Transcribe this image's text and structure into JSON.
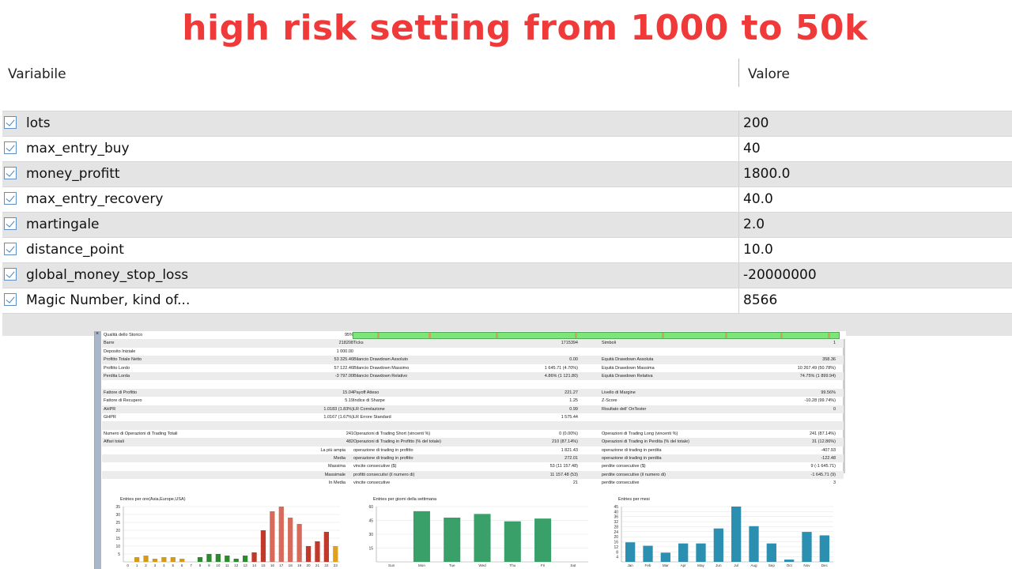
{
  "title": "high risk setting from 1000 to 50k",
  "header": {
    "col1": "Variabile",
    "col2": "Valore"
  },
  "params": [
    {
      "name": "lots",
      "value": "200"
    },
    {
      "name": "max_entry_buy",
      "value": "40"
    },
    {
      "name": "money_profitt",
      "value": "1800.0"
    },
    {
      "name": "max_entry_recovery",
      "value": "40.0"
    },
    {
      "name": "martingale",
      "value": "2.0"
    },
    {
      "name": "distance_point",
      "value": "10.0"
    },
    {
      "name": "global_money_stop_loss",
      "value": "-20000000"
    },
    {
      "name": "Magic Number, kind of...",
      "value": "8566"
    }
  ],
  "report": {
    "close_glyph": "×",
    "rows": [
      [
        "Qualità dello Storico",
        "95%",
        "",
        "",
        "",
        "",
        ""
      ],
      [
        "Barre",
        "218208",
        "Ticks",
        "1715394",
        "Simboli",
        "1",
        ""
      ],
      [
        "Deposito Iniziale",
        "1 000.00",
        "",
        "",
        "",
        "",
        ""
      ],
      [
        "Profitto Totale Netto",
        "53 325.46",
        "Bilancio Drawdown Assoluto",
        "0.00",
        "Equità Drawdown Assoluta",
        "358.36",
        ""
      ],
      [
        "Profitto Lordo",
        "57 122.46",
        "Bilancio Drawdown Massimo",
        "1 645.71 (4.70%)",
        "Equità Drawdown Massima",
        "10 267.49 (50.78%)",
        ""
      ],
      [
        "Perdita Lorda",
        "-3 797.00",
        "Bilancio Drawdown Relativo",
        "4.86% (1 121.80)",
        "Equità Drawdown Relativa",
        "74.75% (1 899.94)",
        ""
      ],
      [
        "",
        "",
        "",
        "",
        "",
        "",
        ""
      ],
      [
        "Fattore di Profitto",
        "15.04",
        "Payoff Atteso",
        "221.27",
        "Livello di Margine",
        "99.56%",
        ""
      ],
      [
        "Fattore di Recupero",
        "5.19",
        "Indice di Sharpe",
        "1.25",
        "Z-Score",
        "-10.28 (99.74%)",
        ""
      ],
      [
        "AHPR",
        "1.0183 (1.83%)",
        "LR Correlazione",
        "0.99",
        "Risultato dell' OnTester",
        "0",
        ""
      ],
      [
        "GHPR",
        "1.0167 (1.67%)",
        "LR Errore Standard",
        "1 575.44",
        "",
        "",
        ""
      ],
      [
        "",
        "",
        "",
        "",
        "",
        "",
        ""
      ],
      [
        "Numero di Operazioni di Trading Totali",
        "241",
        "Operazioni di Trading Short (vincenti %)",
        "0 (0.00%)",
        "Operazioni di Trading Long (vincenti %)",
        "241 (87.14%)",
        ""
      ],
      [
        "Affari totali",
        "482",
        "Operazioni di Trading in Profitto (% del totale)",
        "210 (87.14%)",
        "Operazioni di Trading in Perdita (% del totale)",
        "31 (12.86%)",
        ""
      ],
      [
        "",
        "",
        "operazione di trading in profitto",
        "1 821.43",
        "operazione di trading in perdita",
        "-407.93",
        "La più ampia"
      ],
      [
        "",
        "",
        "operazione di trading in profitto",
        "272.01",
        "operazione di trading in perdita",
        "-122.48",
        "Media"
      ],
      [
        "",
        "",
        "vincite consecutive ($)",
        "53 (11 157.48)",
        "perdite consecutive ($)",
        "9 (-1 645.71)",
        "Massima"
      ],
      [
        "",
        "",
        "profitti consecutivi (il numero di)",
        "11 157.48 (53)",
        "perdite consecutive (il numero di)",
        "-1 645.71 (9)",
        "Massimale"
      ],
      [
        "",
        "",
        "vincite consecutive",
        "21",
        "perdite consecutive",
        "3",
        "In Media"
      ]
    ]
  },
  "charts": {
    "hours": {
      "title": "Entries per ore(Asia,Europe,USA)",
      "yticks": [
        "35",
        "30",
        "25",
        "20",
        "15",
        "10",
        "5"
      ],
      "categories": [
        "0",
        "1",
        "2",
        "3",
        "4",
        "5",
        "6",
        "7",
        "8",
        "9",
        "10",
        "11",
        "12",
        "13",
        "14",
        "15",
        "16",
        "17",
        "18",
        "19",
        "20",
        "21",
        "22",
        "23"
      ],
      "values": [
        0,
        3,
        4,
        2,
        3,
        3,
        2,
        0,
        3,
        5,
        5,
        4,
        2,
        4,
        6,
        20,
        32,
        35,
        28,
        24,
        10,
        13,
        19,
        10
      ],
      "colors": [
        "#d49a1a",
        "#d49a1a",
        "#d49a1a",
        "#d49a1a",
        "#d49a1a",
        "#d49a1a",
        "#d49a1a",
        "#d49a1a",
        "#2f8a2f",
        "#2f8a2f",
        "#2f8a2f",
        "#2f8a2f",
        "#2f8a2f",
        "#2f8a2f",
        "#c0392b",
        "#c0392b",
        "#d76a5a",
        "#d76a5a",
        "#d76a5a",
        "#d76a5a",
        "#c0392b",
        "#c0392b",
        "#c0392b",
        "#e0a020"
      ],
      "ymax": 35
    },
    "weekdays": {
      "title": "Entries per giorni della settimana",
      "yticks": [
        "60",
        "45",
        "30",
        "15"
      ],
      "categories": [
        "Sun",
        "Mon",
        "Tue",
        "Wed",
        "Thu",
        "Fri",
        "Sat"
      ],
      "values": [
        0,
        55,
        48,
        52,
        44,
        47,
        0
      ],
      "ymax": 60,
      "color": "#3aa06a"
    },
    "months": {
      "title": "Entries per mesi",
      "yticks": [
        "45",
        "40",
        "36",
        "32",
        "28",
        "24",
        "20",
        "16",
        "12",
        "8",
        "4"
      ],
      "categories": [
        "Jan",
        "Feb",
        "Mar",
        "Apr",
        "May",
        "Jun",
        "Jul",
        "Aug",
        "Sep",
        "Oct",
        "Nov",
        "Dec"
      ],
      "values": [
        17,
        14,
        8,
        16,
        16,
        29,
        48,
        31,
        16,
        2,
        26,
        23
      ],
      "ymax": 48,
      "color": "#2a8fb0"
    }
  }
}
